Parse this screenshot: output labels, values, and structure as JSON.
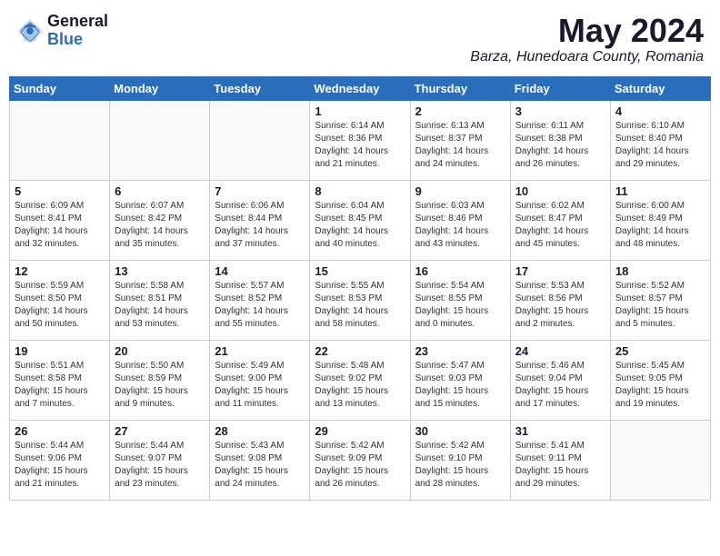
{
  "header": {
    "logo_general": "General",
    "logo_blue": "Blue",
    "month_title": "May 2024",
    "location": "Barza, Hunedoara County, Romania"
  },
  "weekdays": [
    "Sunday",
    "Monday",
    "Tuesday",
    "Wednesday",
    "Thursday",
    "Friday",
    "Saturday"
  ],
  "weeks": [
    [
      {
        "day": "",
        "info": ""
      },
      {
        "day": "",
        "info": ""
      },
      {
        "day": "",
        "info": ""
      },
      {
        "day": "1",
        "info": "Sunrise: 6:14 AM\nSunset: 8:36 PM\nDaylight: 14 hours\nand 21 minutes."
      },
      {
        "day": "2",
        "info": "Sunrise: 6:13 AM\nSunset: 8:37 PM\nDaylight: 14 hours\nand 24 minutes."
      },
      {
        "day": "3",
        "info": "Sunrise: 6:11 AM\nSunset: 8:38 PM\nDaylight: 14 hours\nand 26 minutes."
      },
      {
        "day": "4",
        "info": "Sunrise: 6:10 AM\nSunset: 8:40 PM\nDaylight: 14 hours\nand 29 minutes."
      }
    ],
    [
      {
        "day": "5",
        "info": "Sunrise: 6:09 AM\nSunset: 8:41 PM\nDaylight: 14 hours\nand 32 minutes."
      },
      {
        "day": "6",
        "info": "Sunrise: 6:07 AM\nSunset: 8:42 PM\nDaylight: 14 hours\nand 35 minutes."
      },
      {
        "day": "7",
        "info": "Sunrise: 6:06 AM\nSunset: 8:44 PM\nDaylight: 14 hours\nand 37 minutes."
      },
      {
        "day": "8",
        "info": "Sunrise: 6:04 AM\nSunset: 8:45 PM\nDaylight: 14 hours\nand 40 minutes."
      },
      {
        "day": "9",
        "info": "Sunrise: 6:03 AM\nSunset: 8:46 PM\nDaylight: 14 hours\nand 43 minutes."
      },
      {
        "day": "10",
        "info": "Sunrise: 6:02 AM\nSunset: 8:47 PM\nDaylight: 14 hours\nand 45 minutes."
      },
      {
        "day": "11",
        "info": "Sunrise: 6:00 AM\nSunset: 8:49 PM\nDaylight: 14 hours\nand 48 minutes."
      }
    ],
    [
      {
        "day": "12",
        "info": "Sunrise: 5:59 AM\nSunset: 8:50 PM\nDaylight: 14 hours\nand 50 minutes."
      },
      {
        "day": "13",
        "info": "Sunrise: 5:58 AM\nSunset: 8:51 PM\nDaylight: 14 hours\nand 53 minutes."
      },
      {
        "day": "14",
        "info": "Sunrise: 5:57 AM\nSunset: 8:52 PM\nDaylight: 14 hours\nand 55 minutes."
      },
      {
        "day": "15",
        "info": "Sunrise: 5:55 AM\nSunset: 8:53 PM\nDaylight: 14 hours\nand 58 minutes."
      },
      {
        "day": "16",
        "info": "Sunrise: 5:54 AM\nSunset: 8:55 PM\nDaylight: 15 hours\nand 0 minutes."
      },
      {
        "day": "17",
        "info": "Sunrise: 5:53 AM\nSunset: 8:56 PM\nDaylight: 15 hours\nand 2 minutes."
      },
      {
        "day": "18",
        "info": "Sunrise: 5:52 AM\nSunset: 8:57 PM\nDaylight: 15 hours\nand 5 minutes."
      }
    ],
    [
      {
        "day": "19",
        "info": "Sunrise: 5:51 AM\nSunset: 8:58 PM\nDaylight: 15 hours\nand 7 minutes."
      },
      {
        "day": "20",
        "info": "Sunrise: 5:50 AM\nSunset: 8:59 PM\nDaylight: 15 hours\nand 9 minutes."
      },
      {
        "day": "21",
        "info": "Sunrise: 5:49 AM\nSunset: 9:00 PM\nDaylight: 15 hours\nand 11 minutes."
      },
      {
        "day": "22",
        "info": "Sunrise: 5:48 AM\nSunset: 9:02 PM\nDaylight: 15 hours\nand 13 minutes."
      },
      {
        "day": "23",
        "info": "Sunrise: 5:47 AM\nSunset: 9:03 PM\nDaylight: 15 hours\nand 15 minutes."
      },
      {
        "day": "24",
        "info": "Sunrise: 5:46 AM\nSunset: 9:04 PM\nDaylight: 15 hours\nand 17 minutes."
      },
      {
        "day": "25",
        "info": "Sunrise: 5:45 AM\nSunset: 9:05 PM\nDaylight: 15 hours\nand 19 minutes."
      }
    ],
    [
      {
        "day": "26",
        "info": "Sunrise: 5:44 AM\nSunset: 9:06 PM\nDaylight: 15 hours\nand 21 minutes."
      },
      {
        "day": "27",
        "info": "Sunrise: 5:44 AM\nSunset: 9:07 PM\nDaylight: 15 hours\nand 23 minutes."
      },
      {
        "day": "28",
        "info": "Sunrise: 5:43 AM\nSunset: 9:08 PM\nDaylight: 15 hours\nand 24 minutes."
      },
      {
        "day": "29",
        "info": "Sunrise: 5:42 AM\nSunset: 9:09 PM\nDaylight: 15 hours\nand 26 minutes."
      },
      {
        "day": "30",
        "info": "Sunrise: 5:42 AM\nSunset: 9:10 PM\nDaylight: 15 hours\nand 28 minutes."
      },
      {
        "day": "31",
        "info": "Sunrise: 5:41 AM\nSunset: 9:11 PM\nDaylight: 15 hours\nand 29 minutes."
      },
      {
        "day": "",
        "info": ""
      }
    ]
  ]
}
